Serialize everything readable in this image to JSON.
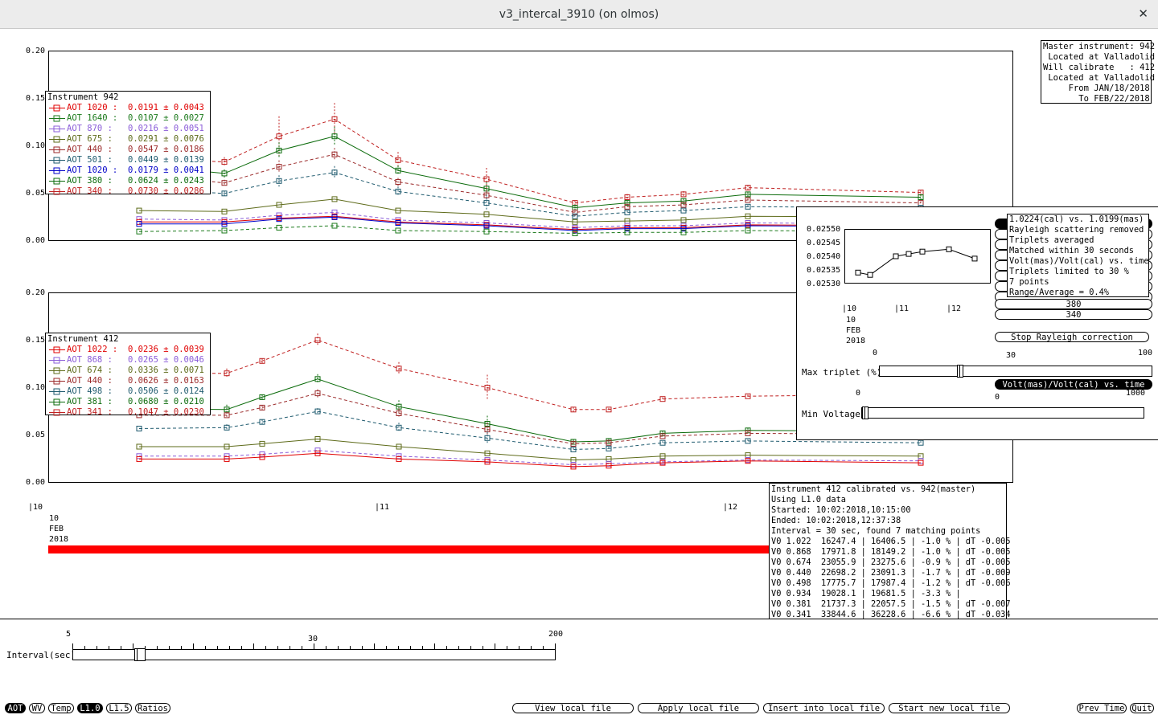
{
  "window": {
    "title": "v3_intercal_3910 (on olmos)",
    "close_icon": "✕"
  },
  "colors": {
    "red": "#e00000",
    "darkred": "#a01c1c",
    "green": "#1b7a1b",
    "violet": "#8a5cd8",
    "olive": "#5e6b1a",
    "brown": "#9b2a2a",
    "teal": "#1e5a6e",
    "blue": "#0000c8",
    "darkgreen": "#0b6b0b",
    "crimson": "#c02020"
  },
  "top_plot": {
    "yticks": [
      "0.20",
      "0.15",
      "0.10",
      "0.05",
      "0.00"
    ],
    "legend": {
      "title": "Instrument 942",
      "rows": [
        {
          "label": "AOT 1020 :",
          "value": "0.0191 ± 0.0043",
          "color": "#e00000"
        },
        {
          "label": "AOT 1640 :",
          "value": "0.0107 ± 0.0027",
          "color": "#1b7a1b"
        },
        {
          "label": "AOT 870 :",
          "value": "0.0216 ± 0.0051",
          "color": "#8a5cd8"
        },
        {
          "label": "AOT 675 :",
          "value": "0.0291 ± 0.0076",
          "color": "#5e6b1a"
        },
        {
          "label": "AOT 440 :",
          "value": "0.0547 ± 0.0186",
          "color": "#9b2a2a"
        },
        {
          "label": "AOT 501 :",
          "value": "0.0449 ± 0.0139",
          "color": "#1e5a6e"
        },
        {
          "label": "AOT 1020 :",
          "value": "0.0179 ± 0.0041",
          "color": "#0000c8"
        },
        {
          "label": "AOT 380 :",
          "value": "0.0624 ± 0.0243",
          "color": "#0b6b0b"
        },
        {
          "label": "AOT 340 :",
          "value": "0.0730 ± 0.0286",
          "color": "#c02020"
        }
      ]
    }
  },
  "bottom_plot": {
    "yticks": [
      "0.20",
      "0.15",
      "0.10",
      "0.05",
      "0.00"
    ],
    "legend": {
      "title": "Instrument 412",
      "rows": [
        {
          "label": "AOT 1022 :",
          "value": "0.0236 ± 0.0039",
          "color": "#e00000"
        },
        {
          "label": "AOT 868 :",
          "value": "0.0265 ± 0.0046",
          "color": "#8a5cd8"
        },
        {
          "label": "AOT 674 :",
          "value": "0.0336 ± 0.0071",
          "color": "#5e6b1a"
        },
        {
          "label": "AOT 440 :",
          "value": "0.0626 ± 0.0163",
          "color": "#9b2a2a"
        },
        {
          "label": "AOT 498 :",
          "value": "0.0506 ± 0.0124",
          "color": "#1e5a6e"
        },
        {
          "label": "AOT 381 :",
          "value": "0.0680 ± 0.0210",
          "color": "#0b6b0b"
        },
        {
          "label": "AOT 341 :",
          "value": "0.1047 ± 0.0230",
          "color": "#c02020"
        }
      ]
    }
  },
  "x_axis": {
    "tick_10": "|10",
    "tick_11": "|11",
    "tick_12": "|12",
    "date_day": "10",
    "date_month": "FEB",
    "date_year": "2018"
  },
  "master_info": "Master instrument: 942\n Located at Valladolid\nWill calibrate   : 412\n Located at Valladolid\n     From JAN/18/2018\n       To FEB/22/2018",
  "cal_panel": {
    "yticks": [
      "0.02550",
      "0.02545",
      "0.02540",
      "0.02535",
      "0.02530"
    ],
    "values": [
      0.02533,
      0.02532,
      0.0254,
      0.02541,
      0.02542,
      0.02543,
      0.02539
    ],
    "xtick_10": "|10",
    "xtick_11": "|11",
    "xtick_12": "|12",
    "date_day": "10",
    "date_month": "FEB",
    "date_year": "2018",
    "menu": [
      "1.0224(cal) vs. 1.0199(mas)",
      "Rayleigh scattering removed",
      "Triplets averaged",
      "Matched within 30 seconds",
      "Volt(mas)/Volt(cal) vs. time",
      "Triplets limited to 30 %",
      "7 points",
      "Range/Average = 0.4%"
    ],
    "btn_380": "380",
    "btn_340": "340",
    "stop_rayleigh": "Stop Rayleigh correction",
    "max_triplet_label": "Max triplet (%)",
    "max_triplet_min": "0",
    "max_triplet_mid": "30",
    "max_triplet_max": "100",
    "volt_ratio_label": "Volt(mas)/Volt(cal) vs. time",
    "min_voltage_label": "Min Voltage",
    "min_voltage_min": "0",
    "min_voltage_mid": "0",
    "min_voltage_max": "1000"
  },
  "calib_info": "Instrument 412 calibrated vs. 942(master)\nUsing L1.0 data\nStarted: 10:02:2018,10:15:00\nEnded: 10:02:2018,12:37:38\nInterval = 30 sec, found 7 matching points\nV0 1.022  16247.4 | 16406.5 | -1.0 % | dT -0.005\nV0 0.868  17971.8 | 18149.2 | -1.0 % | dT -0.005\nV0 0.674  23055.9 | 23275.6 | -0.9 % | dT -0.005\nV0 0.440  22698.2 | 23091.3 | -1.7 % | dT -0.009\nV0 0.498  17775.7 | 17987.4 | -1.2 % | dT -0.006\nV0 0.934  19028.1 | 19681.5 | -3.3 % |\nV0 0.381  21737.3 | 22057.5 | -1.5 % | dT -0.007\nV0 0.341  33844.6 | 36228.6 | -6.6 % | dT -0.034",
  "interval": {
    "label": "Interval(sec)",
    "min": "5",
    "mid": "30",
    "max": "200"
  },
  "bottom_buttons": {
    "aot": "AOT",
    "wv": "WV",
    "temp": "Temp",
    "l10": "L1.0",
    "l15": "L1.5",
    "ratios": "Ratios",
    "view_local": "View local file",
    "apply_local": "Apply local file",
    "insert_local": "Insert into local file",
    "start_new": "Start new local file",
    "prev_time": "Prev Time",
    "quit": "Quit"
  }
}
